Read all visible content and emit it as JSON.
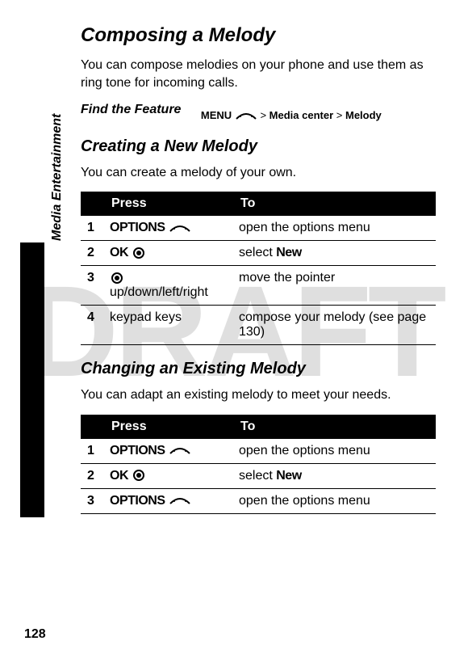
{
  "watermark": "DRAFT",
  "sidebar_label": "Media Entertainment",
  "page_number": "128",
  "h1": "Composing a Melody",
  "intro1": "You can compose melodies on your phone and use them as ring tone for incoming calls.",
  "find_feature_label": "Find the Feature",
  "find_path": {
    "menu": "MENU",
    "sep": ">",
    "item1": "Media center",
    "item2": "Melody"
  },
  "h2a": "Creating a New Melody",
  "intro2": "You can create a melody of your own.",
  "table_headers": {
    "press": "Press",
    "to": "To"
  },
  "table1": {
    "r1": {
      "n": "1",
      "press_label": "OPTIONS",
      "to": "open the options menu"
    },
    "r2": {
      "n": "2",
      "press_label": "OK",
      "to_pre": "select ",
      "to_bold": "New"
    },
    "r3": {
      "n": "3",
      "press_post": " up/down/left/right",
      "to": "move the pointer"
    },
    "r4": {
      "n": "4",
      "press_text": "keypad keys",
      "to": "compose your melody  (see page 130)"
    }
  },
  "h2b": "Changing an Existing Melody",
  "intro3": "You can adapt an existing melody to meet your needs.",
  "table2": {
    "r1": {
      "n": "1",
      "press_label": "OPTIONS",
      "to": "open the options menu"
    },
    "r2": {
      "n": "2",
      "press_label": "OK",
      "to_pre": "select ",
      "to_bold": "New"
    },
    "r3": {
      "n": "3",
      "press_label": "OPTIONS",
      "to": "open the options menu"
    }
  }
}
